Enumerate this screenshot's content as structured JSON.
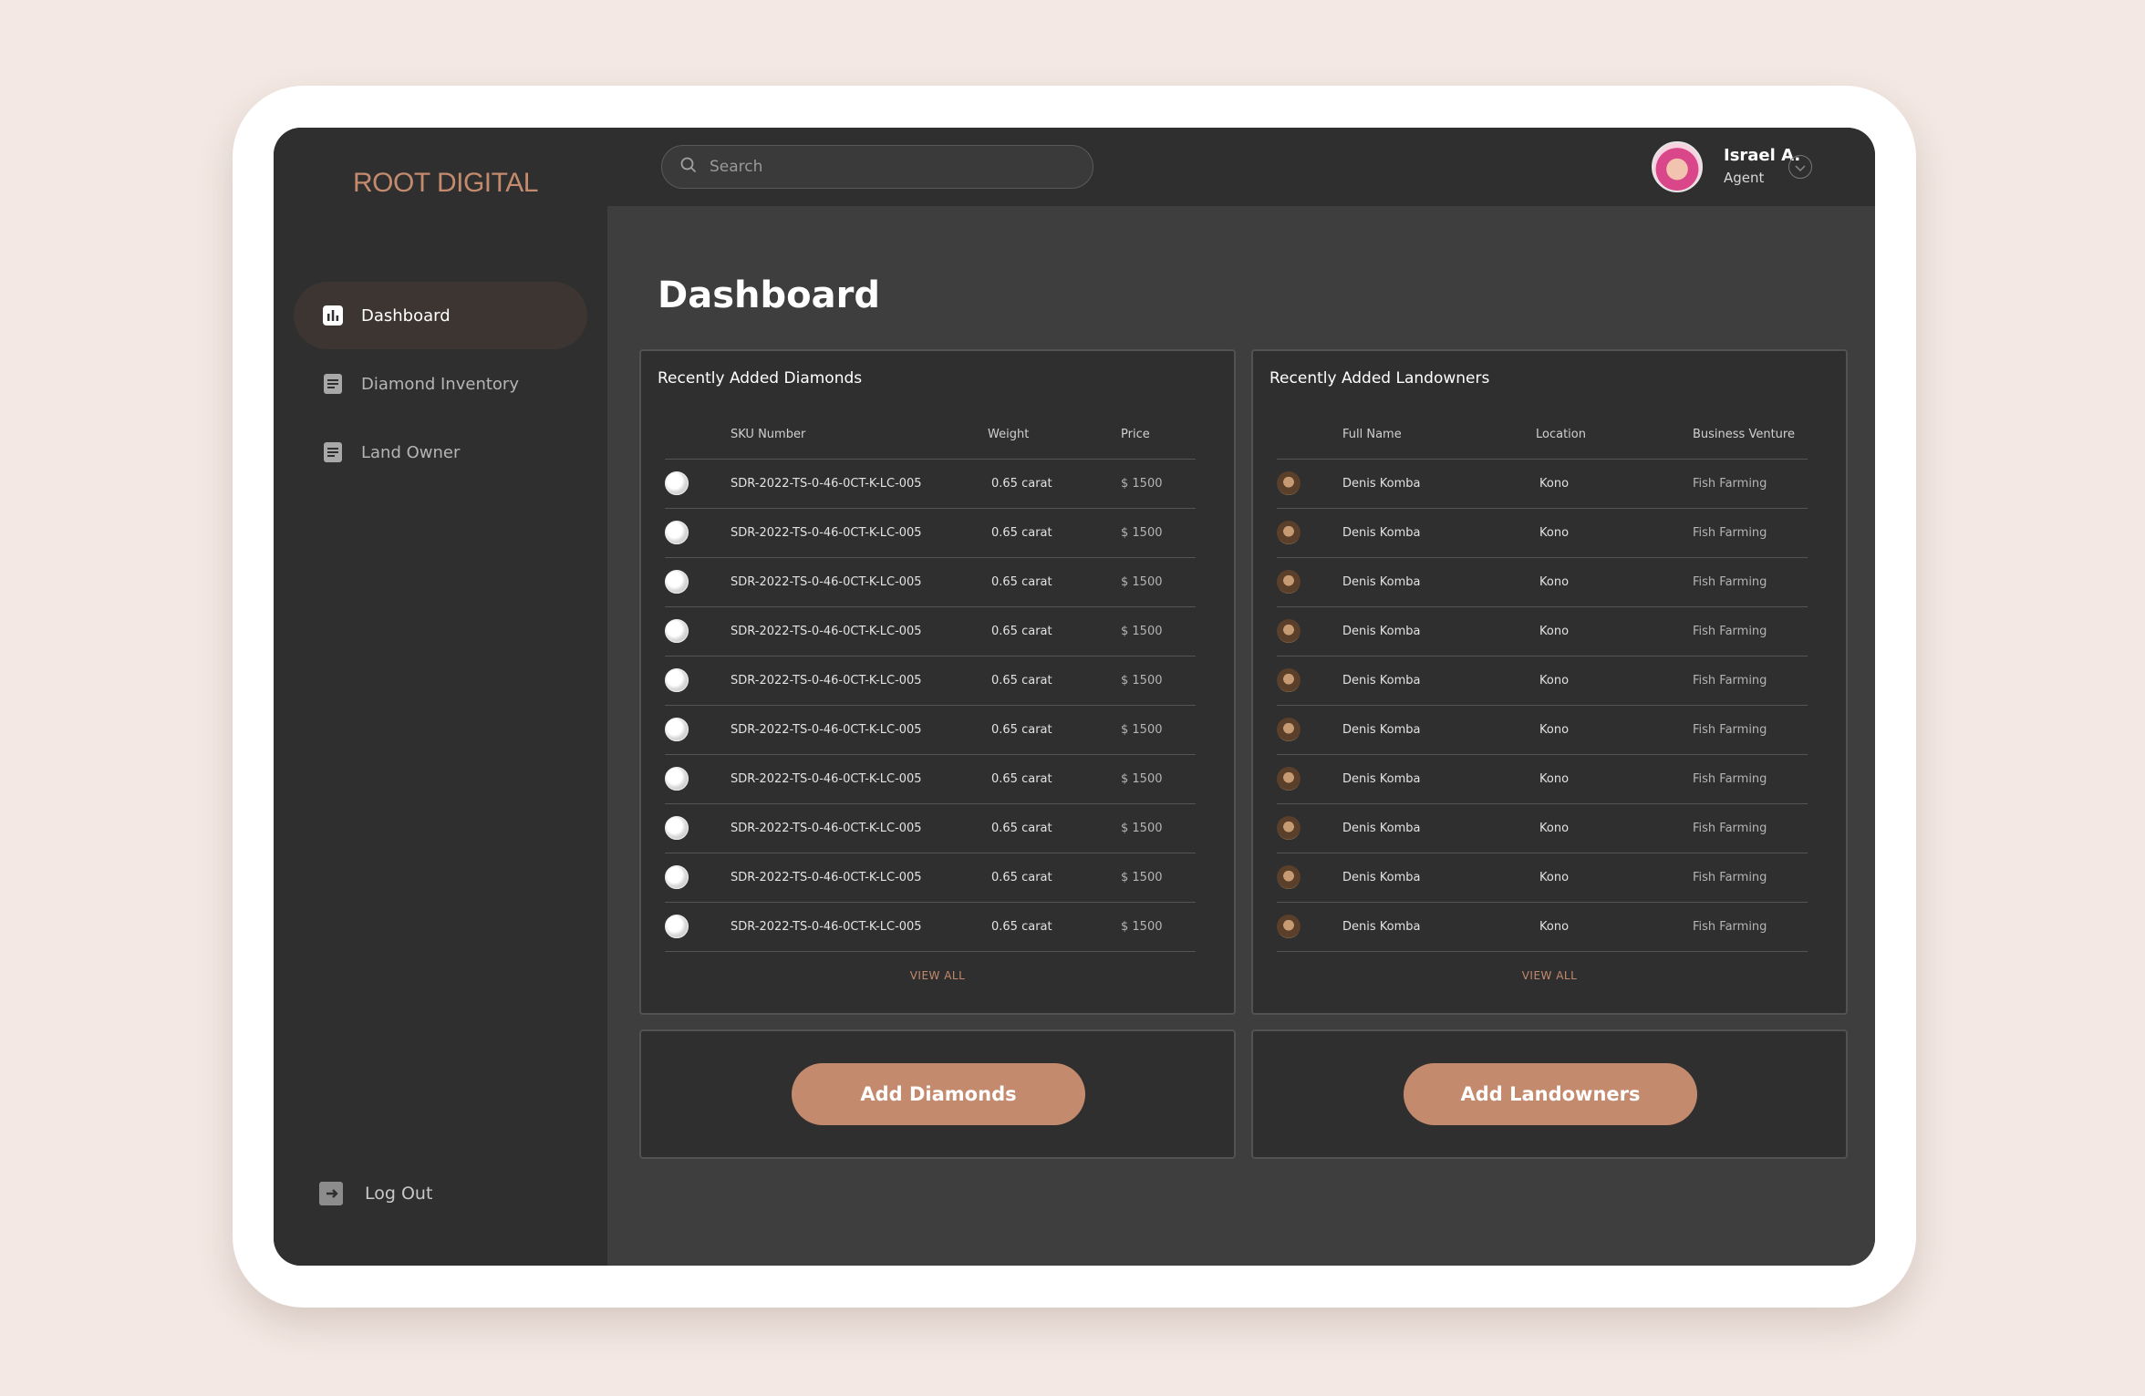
{
  "app": {
    "logo": "ROOT DIGITAL"
  },
  "sidebar": {
    "items": [
      {
        "label": "Dashboard",
        "icon": "bar-chart-icon",
        "active": true
      },
      {
        "label": "Diamond Inventory",
        "icon": "document-icon",
        "active": false
      },
      {
        "label": "Land Owner",
        "icon": "document-icon",
        "active": false
      }
    ],
    "logout_label": "Log Out"
  },
  "header": {
    "search_placeholder": "Search",
    "user_name": "Israel A.",
    "user_role": "Agent"
  },
  "main": {
    "title": "Dashboard",
    "diamonds": {
      "title": "Recently Added Diamonds",
      "columns": [
        "SKU Number",
        "Weight",
        "Price"
      ],
      "rows": [
        {
          "sku": "SDR-2022-TS-0-46-0CT-K-LC-005",
          "weight": "0.65 carat",
          "price": "$ 1500"
        },
        {
          "sku": "SDR-2022-TS-0-46-0CT-K-LC-005",
          "weight": "0.65 carat",
          "price": "$ 1500"
        },
        {
          "sku": "SDR-2022-TS-0-46-0CT-K-LC-005",
          "weight": "0.65 carat",
          "price": "$ 1500"
        },
        {
          "sku": "SDR-2022-TS-0-46-0CT-K-LC-005",
          "weight": "0.65 carat",
          "price": "$ 1500"
        },
        {
          "sku": "SDR-2022-TS-0-46-0CT-K-LC-005",
          "weight": "0.65 carat",
          "price": "$ 1500"
        },
        {
          "sku": "SDR-2022-TS-0-46-0CT-K-LC-005",
          "weight": "0.65 carat",
          "price": "$ 1500"
        },
        {
          "sku": "SDR-2022-TS-0-46-0CT-K-LC-005",
          "weight": "0.65 carat",
          "price": "$ 1500"
        },
        {
          "sku": "SDR-2022-TS-0-46-0CT-K-LC-005",
          "weight": "0.65 carat",
          "price": "$ 1500"
        },
        {
          "sku": "SDR-2022-TS-0-46-0CT-K-LC-005",
          "weight": "0.65 carat",
          "price": "$ 1500"
        },
        {
          "sku": "SDR-2022-TS-0-46-0CT-K-LC-005",
          "weight": "0.65 carat",
          "price": "$ 1500"
        }
      ],
      "view_all": "VIEW ALL",
      "add_button": "Add Diamonds"
    },
    "landowners": {
      "title": "Recently Added Landowners",
      "columns": [
        "Full Name",
        "Location",
        "Business Venture"
      ],
      "rows": [
        {
          "name": "Denis Komba",
          "location": "Kono",
          "venture": "Fish Farming"
        },
        {
          "name": "Denis Komba",
          "location": "Kono",
          "venture": "Fish Farming"
        },
        {
          "name": "Denis Komba",
          "location": "Kono",
          "venture": "Fish Farming"
        },
        {
          "name": "Denis Komba",
          "location": "Kono",
          "venture": "Fish Farming"
        },
        {
          "name": "Denis Komba",
          "location": "Kono",
          "venture": "Fish Farming"
        },
        {
          "name": "Denis Komba",
          "location": "Kono",
          "venture": "Fish Farming"
        },
        {
          "name": "Denis Komba",
          "location": "Kono",
          "venture": "Fish Farming"
        },
        {
          "name": "Denis Komba",
          "location": "Kono",
          "venture": "Fish Farming"
        },
        {
          "name": "Denis Komba",
          "location": "Kono",
          "venture": "Fish Farming"
        },
        {
          "name": "Denis Komba",
          "location": "Kono",
          "venture": "Fish Farming"
        }
      ],
      "view_all": "VIEW ALL",
      "add_button": "Add Landowners"
    }
  },
  "colors": {
    "accent": "#c48a6e",
    "background": "#f3e8e3",
    "panel": "#2f2f2f",
    "main": "#3e3e3e"
  }
}
